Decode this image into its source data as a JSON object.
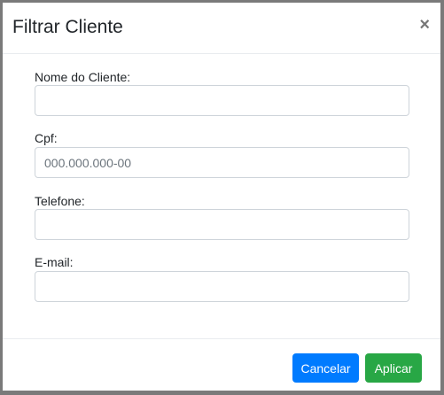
{
  "modal": {
    "title": "Filtrar Cliente",
    "close_label": "×"
  },
  "fields": [
    {
      "label": "Nome do Cliente:",
      "value": "",
      "placeholder": ""
    },
    {
      "label": "Cpf:",
      "value": "",
      "placeholder": "000.000.000-00"
    },
    {
      "label": "Telefone:",
      "value": "",
      "placeholder": ""
    },
    {
      "label": "E-mail:",
      "value": "",
      "placeholder": ""
    }
  ],
  "footer": {
    "cancel_label": "Cancelar",
    "apply_label": "Aplicar"
  },
  "colors": {
    "cancel": "#007bff",
    "apply": "#28a745"
  }
}
